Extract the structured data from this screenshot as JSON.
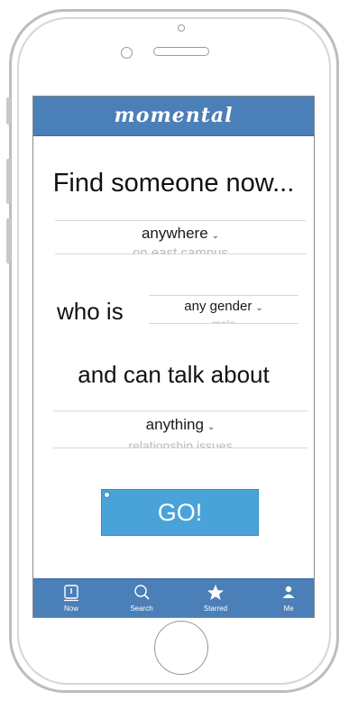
{
  "app": {
    "logo": "momental"
  },
  "main": {
    "heading": "Find someone now...",
    "location_picker": {
      "selected": "anywhere",
      "next_option": "on east campus",
      "chevron": "⌄"
    },
    "who_is_label": "who is",
    "gender_picker": {
      "selected": "any gender",
      "next_option": "male",
      "chevron": "⌄"
    },
    "talk_label": "and can talk about",
    "topic_picker": {
      "selected": "anything",
      "next_option": "relationship issues",
      "chevron": "⌄"
    },
    "go_label": "GO!"
  },
  "tabbar": {
    "items": [
      {
        "label": "Now",
        "icon": "now-icon"
      },
      {
        "label": "Search",
        "icon": "search-icon"
      },
      {
        "label": "Starred",
        "icon": "star-icon"
      },
      {
        "label": "Me",
        "icon": "person-icon"
      }
    ]
  },
  "colors": {
    "brand_blue": "#4a7fb8",
    "button_blue": "#4aa3d8",
    "frame_gray": "#bdbdbd"
  }
}
